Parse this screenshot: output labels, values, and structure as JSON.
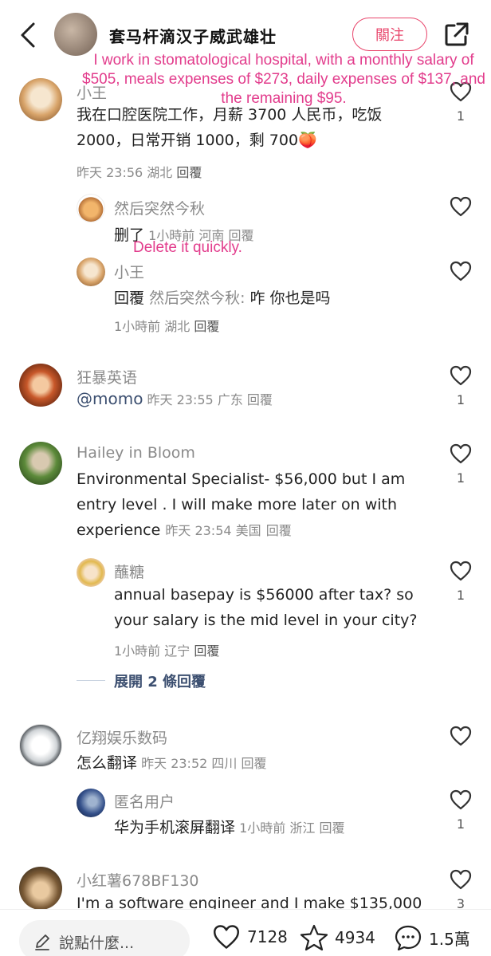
{
  "header": {
    "author": "套马杆滴汉子威武雄壮",
    "follow_label": "關注"
  },
  "overlays": {
    "top_translation": "I work in stomatological hospital, with a monthly salary of $505, meals expenses of $273, daily expenses of $137, and the remaining $95.",
    "mid_translation": "Delete it quickly."
  },
  "comments": [
    {
      "username": "小王",
      "text_line1": "我在口腔医院工作，月薪 3700 人民币，吃饭",
      "text_line2": "2000，日常开销 1000，剩 700",
      "emoji": "🍑",
      "meta_time": "昨天 23:56 湖北",
      "reply": "回覆",
      "likes": "1",
      "replies": [
        {
          "username": "然后突然今秋",
          "text": "删了",
          "meta_time": "1小時前 河南",
          "reply": "回覆"
        },
        {
          "username": "小王",
          "text_prefix": "回覆",
          "text_target": "然后突然今秋:",
          "text": "咋 你也是吗",
          "meta_time": "1小時前 湖北",
          "reply": "回覆"
        }
      ]
    },
    {
      "username": "狂暴英语",
      "mention": "@momo",
      "meta_time": "昨天 23:55 广东",
      "reply": "回覆",
      "likes": "1"
    },
    {
      "username": "Hailey in Bloom",
      "text_line1": "Environmental Specialist- $56,000 but I am",
      "text_line2": "entry level . I will make more later on with",
      "text_line3": "experience",
      "meta_time": "昨天 23:54 美国",
      "reply": "回覆",
      "likes": "1",
      "replies": [
        {
          "username": "蘸糖",
          "text_line1": "annual basepay is $56000 after tax? so",
          "text_line2": "your salary is the mid level in your city?",
          "meta_time": "1小時前 辽宁",
          "reply": "回覆",
          "likes": "1"
        }
      ],
      "expand_label": "展開 2 條回覆"
    },
    {
      "username": "亿翔娱乐数码",
      "text": "怎么翻译",
      "meta_time": "昨天 23:52 四川",
      "reply": "回覆",
      "replies": [
        {
          "username": "匿名用户",
          "text": "华为手机滚屏翻译",
          "meta_time": "1小時前 浙江",
          "reply": "回覆",
          "likes": "1"
        }
      ]
    },
    {
      "username": "小红薯678BF130",
      "text": "I'm a software engineer and I make $135,000",
      "likes": "3"
    }
  ],
  "bottom_bar": {
    "input_placeholder": "說點什麼...",
    "likes": "7128",
    "favorites": "4934",
    "comments": "1.5萬"
  },
  "colors": {
    "accent": "#e8456b",
    "overlay": "#e23c8c",
    "link": "#3c4f70"
  }
}
